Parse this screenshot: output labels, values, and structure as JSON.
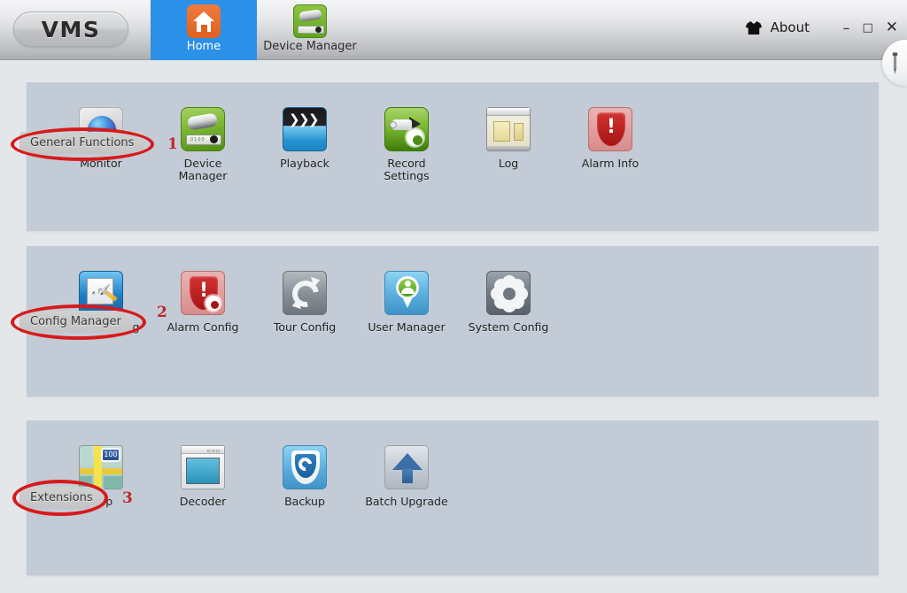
{
  "app": {
    "logo": "VMS",
    "about_label": "About",
    "about_icon": "shirt-icon"
  },
  "titlebar": {
    "tabs": [
      {
        "label": "Home",
        "icon": "home-icon",
        "active": true
      },
      {
        "label": "Device Manager",
        "icon": "device-manager-icon",
        "active": false
      }
    ],
    "window_controls": {
      "minimize": "–",
      "maximize": "□",
      "close": "✕"
    },
    "side_tab_icon": "pin-icon"
  },
  "annotations": [
    {
      "number": "1",
      "target": "General Functions"
    },
    {
      "number": "2",
      "target": "Config Manager"
    },
    {
      "number": "3",
      "target": "Extensions"
    }
  ],
  "sections": [
    {
      "title": "General Functions",
      "items": [
        {
          "label": "Monitor",
          "icon": "monitor-icon"
        },
        {
          "label": "Device Manager",
          "icon": "device-manager-icon"
        },
        {
          "label": "Playback",
          "icon": "playback-icon"
        },
        {
          "label": "Record\nSettings",
          "icon": "record-settings-icon"
        },
        {
          "label": "Log",
          "icon": "log-icon"
        },
        {
          "label": "Alarm Info",
          "icon": "alarm-info-icon"
        }
      ]
    },
    {
      "title": "Config Manager",
      "items": [
        {
          "label": "Device Config",
          "icon": "device-config-icon"
        },
        {
          "label": "Alarm Config",
          "icon": "alarm-config-icon"
        },
        {
          "label": "Tour Config",
          "icon": "tour-config-icon"
        },
        {
          "label": "User Manager",
          "icon": "user-manager-icon"
        },
        {
          "label": "System Config",
          "icon": "system-config-icon"
        }
      ]
    },
    {
      "title": "Extensions",
      "items": [
        {
          "label": "Map",
          "icon": "map-icon"
        },
        {
          "label": "Decoder",
          "icon": "decoder-icon"
        },
        {
          "label": "Backup",
          "icon": "backup-icon"
        },
        {
          "label": "Batch Upgrade",
          "icon": "batch-upgrade-icon"
        }
      ]
    }
  ],
  "colors": {
    "accent_tab": "#2b90e8",
    "panel_bg": "#c3cbd6",
    "page_bg": "#e4e7ea",
    "annotation_red": "#d71a1a",
    "annotation_number": "#c0272d"
  },
  "icon_text": {
    "map_sign": "100",
    "decoder_dots": "▫▫▫",
    "devmgr_digits": "0100"
  }
}
